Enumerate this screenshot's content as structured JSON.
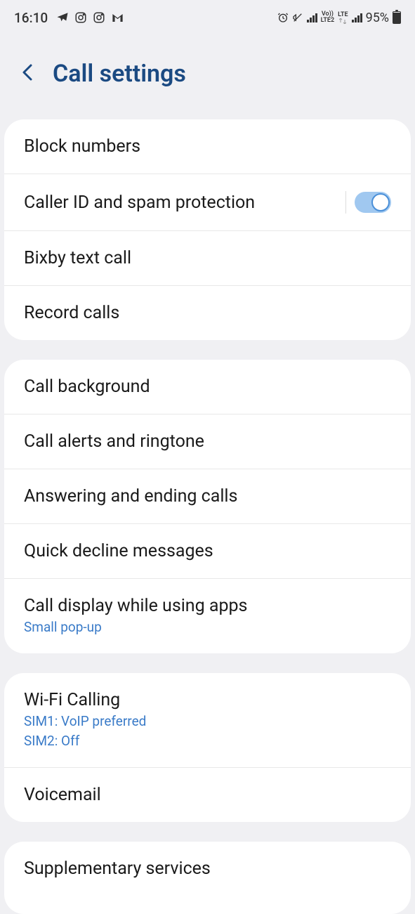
{
  "statusBar": {
    "time": "16:10",
    "battery": "95%",
    "network1Label": "Vo))",
    "network2Label": "LTE2",
    "lteLabel": "LTE"
  },
  "header": {
    "title": "Call settings"
  },
  "group1": {
    "blockNumbers": "Block numbers",
    "callerIdSpam": "Caller ID and spam protection",
    "bixbyTextCall": "Bixby text call",
    "recordCalls": "Record calls"
  },
  "group2": {
    "callBackground": "Call background",
    "callAlerts": "Call alerts and ringtone",
    "answering": "Answering and ending calls",
    "quickDecline": "Quick decline messages",
    "callDisplay": "Call display while using apps",
    "callDisplaySub": "Small pop-up"
  },
  "group3": {
    "wifiCalling": "Wi-Fi Calling",
    "wifiCallingSub1": "SIM1: VoIP preferred",
    "wifiCallingSub2": "SIM2: Off",
    "voicemail": "Voicemail"
  },
  "group4": {
    "supplementary": "Supplementary services"
  }
}
